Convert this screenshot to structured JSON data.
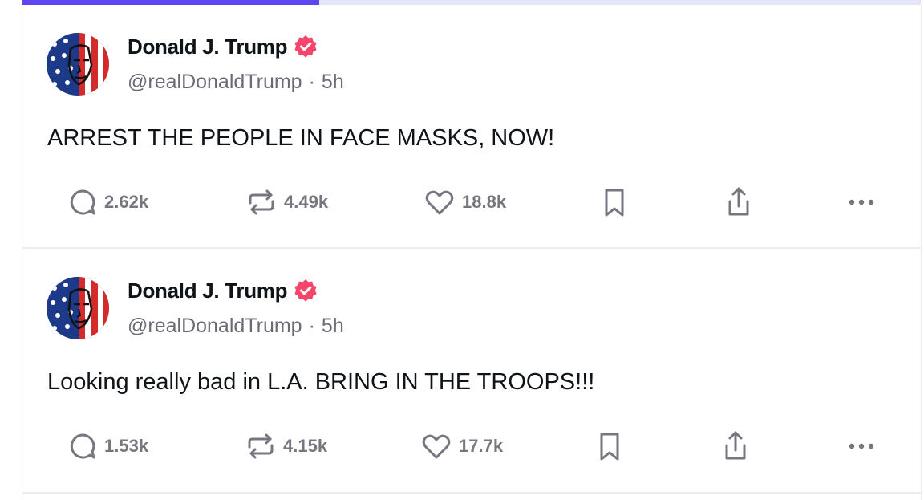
{
  "progress": {
    "fraction": 0.33,
    "fill_color": "#5b46f0",
    "track_color": "#e3e6fb"
  },
  "colors": {
    "verified": "#f5456a",
    "icon": "#76767f",
    "muted_text": "#6b6b77"
  },
  "posts": [
    {
      "author": {
        "display_name": "Donald J. Trump",
        "handle": "@realDonaldTrump",
        "verified_icon": "verified-badge-icon",
        "avatar": "avatar"
      },
      "separator": "·",
      "time": "5h",
      "text": "ARREST THE PEOPLE IN FACE MASKS, NOW!",
      "stats": {
        "replies": "2.62k",
        "reposts": "4.49k",
        "likes": "18.8k"
      },
      "icons": [
        "reply-icon",
        "repost-icon",
        "like-icon",
        "bookmark-icon",
        "share-icon",
        "more-icon"
      ]
    },
    {
      "author": {
        "display_name": "Donald J. Trump",
        "handle": "@realDonaldTrump",
        "verified_icon": "verified-badge-icon",
        "avatar": "avatar"
      },
      "separator": "·",
      "time": "5h",
      "text": "Looking really bad in L.A. BRING IN THE TROOPS!!!",
      "stats": {
        "replies": "1.53k",
        "reposts": "4.15k",
        "likes": "17.7k"
      },
      "icons": [
        "reply-icon",
        "repost-icon",
        "like-icon",
        "bookmark-icon",
        "share-icon",
        "more-icon"
      ]
    }
  ]
}
